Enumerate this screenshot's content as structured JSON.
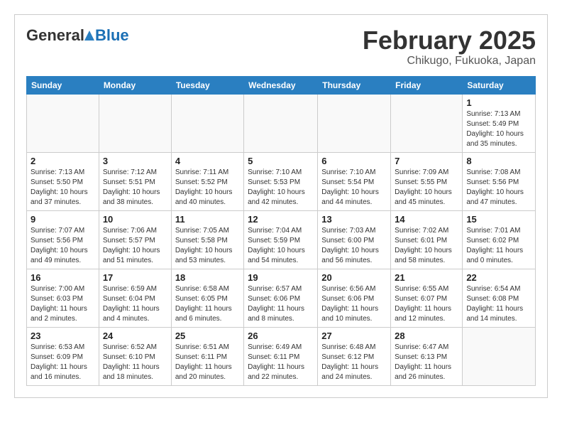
{
  "logo": {
    "general": "General",
    "blue": "Blue"
  },
  "header": {
    "month": "February 2025",
    "location": "Chikugo, Fukuoka, Japan"
  },
  "weekdays": [
    "Sunday",
    "Monday",
    "Tuesday",
    "Wednesday",
    "Thursday",
    "Friday",
    "Saturday"
  ],
  "weeks": [
    [
      {
        "day": "",
        "info": ""
      },
      {
        "day": "",
        "info": ""
      },
      {
        "day": "",
        "info": ""
      },
      {
        "day": "",
        "info": ""
      },
      {
        "day": "",
        "info": ""
      },
      {
        "day": "",
        "info": ""
      },
      {
        "day": "1",
        "info": "Sunrise: 7:13 AM\nSunset: 5:49 PM\nDaylight: 10 hours and 35 minutes."
      }
    ],
    [
      {
        "day": "2",
        "info": "Sunrise: 7:13 AM\nSunset: 5:50 PM\nDaylight: 10 hours and 37 minutes."
      },
      {
        "day": "3",
        "info": "Sunrise: 7:12 AM\nSunset: 5:51 PM\nDaylight: 10 hours and 38 minutes."
      },
      {
        "day": "4",
        "info": "Sunrise: 7:11 AM\nSunset: 5:52 PM\nDaylight: 10 hours and 40 minutes."
      },
      {
        "day": "5",
        "info": "Sunrise: 7:10 AM\nSunset: 5:53 PM\nDaylight: 10 hours and 42 minutes."
      },
      {
        "day": "6",
        "info": "Sunrise: 7:10 AM\nSunset: 5:54 PM\nDaylight: 10 hours and 44 minutes."
      },
      {
        "day": "7",
        "info": "Sunrise: 7:09 AM\nSunset: 5:55 PM\nDaylight: 10 hours and 45 minutes."
      },
      {
        "day": "8",
        "info": "Sunrise: 7:08 AM\nSunset: 5:56 PM\nDaylight: 10 hours and 47 minutes."
      }
    ],
    [
      {
        "day": "9",
        "info": "Sunrise: 7:07 AM\nSunset: 5:56 PM\nDaylight: 10 hours and 49 minutes."
      },
      {
        "day": "10",
        "info": "Sunrise: 7:06 AM\nSunset: 5:57 PM\nDaylight: 10 hours and 51 minutes."
      },
      {
        "day": "11",
        "info": "Sunrise: 7:05 AM\nSunset: 5:58 PM\nDaylight: 10 hours and 53 minutes."
      },
      {
        "day": "12",
        "info": "Sunrise: 7:04 AM\nSunset: 5:59 PM\nDaylight: 10 hours and 54 minutes."
      },
      {
        "day": "13",
        "info": "Sunrise: 7:03 AM\nSunset: 6:00 PM\nDaylight: 10 hours and 56 minutes."
      },
      {
        "day": "14",
        "info": "Sunrise: 7:02 AM\nSunset: 6:01 PM\nDaylight: 10 hours and 58 minutes."
      },
      {
        "day": "15",
        "info": "Sunrise: 7:01 AM\nSunset: 6:02 PM\nDaylight: 11 hours and 0 minutes."
      }
    ],
    [
      {
        "day": "16",
        "info": "Sunrise: 7:00 AM\nSunset: 6:03 PM\nDaylight: 11 hours and 2 minutes."
      },
      {
        "day": "17",
        "info": "Sunrise: 6:59 AM\nSunset: 6:04 PM\nDaylight: 11 hours and 4 minutes."
      },
      {
        "day": "18",
        "info": "Sunrise: 6:58 AM\nSunset: 6:05 PM\nDaylight: 11 hours and 6 minutes."
      },
      {
        "day": "19",
        "info": "Sunrise: 6:57 AM\nSunset: 6:06 PM\nDaylight: 11 hours and 8 minutes."
      },
      {
        "day": "20",
        "info": "Sunrise: 6:56 AM\nSunset: 6:06 PM\nDaylight: 11 hours and 10 minutes."
      },
      {
        "day": "21",
        "info": "Sunrise: 6:55 AM\nSunset: 6:07 PM\nDaylight: 11 hours and 12 minutes."
      },
      {
        "day": "22",
        "info": "Sunrise: 6:54 AM\nSunset: 6:08 PM\nDaylight: 11 hours and 14 minutes."
      }
    ],
    [
      {
        "day": "23",
        "info": "Sunrise: 6:53 AM\nSunset: 6:09 PM\nDaylight: 11 hours and 16 minutes."
      },
      {
        "day": "24",
        "info": "Sunrise: 6:52 AM\nSunset: 6:10 PM\nDaylight: 11 hours and 18 minutes."
      },
      {
        "day": "25",
        "info": "Sunrise: 6:51 AM\nSunset: 6:11 PM\nDaylight: 11 hours and 20 minutes."
      },
      {
        "day": "26",
        "info": "Sunrise: 6:49 AM\nSunset: 6:11 PM\nDaylight: 11 hours and 22 minutes."
      },
      {
        "day": "27",
        "info": "Sunrise: 6:48 AM\nSunset: 6:12 PM\nDaylight: 11 hours and 24 minutes."
      },
      {
        "day": "28",
        "info": "Sunrise: 6:47 AM\nSunset: 6:13 PM\nDaylight: 11 hours and 26 minutes."
      },
      {
        "day": "",
        "info": ""
      }
    ]
  ]
}
